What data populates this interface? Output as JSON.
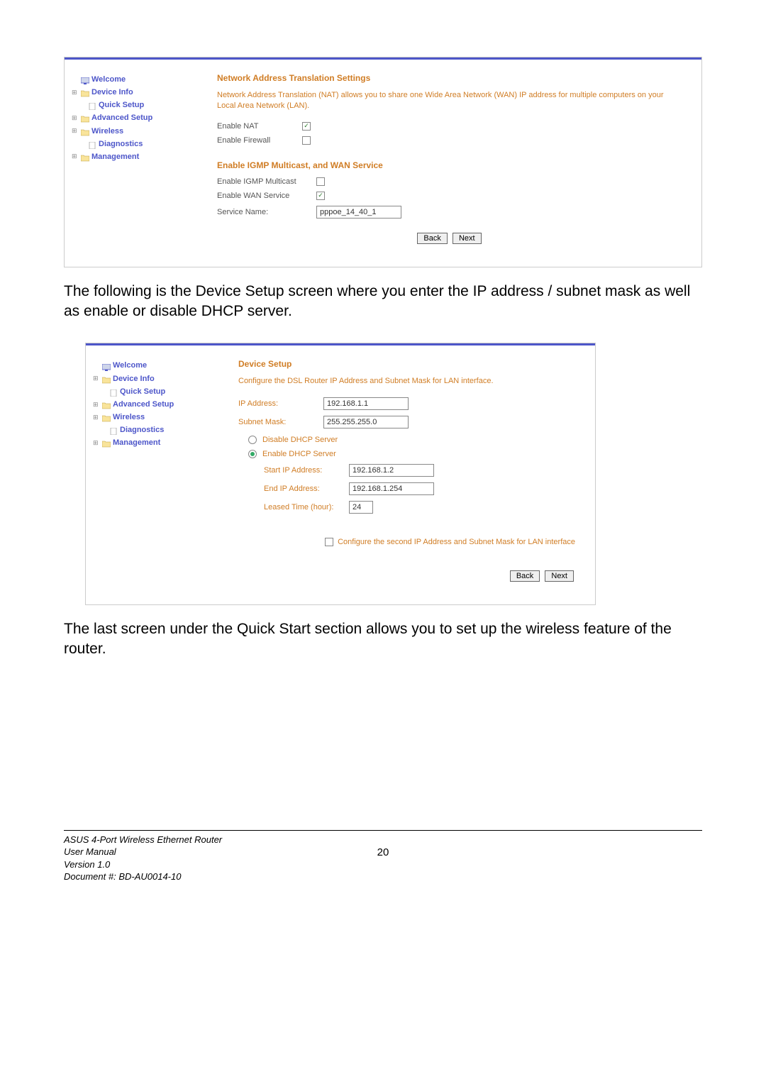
{
  "tree": {
    "welcome": "Welcome",
    "deviceInfo": "Device Info",
    "quickSetup": "Quick Setup",
    "advancedSetup": "Advanced Setup",
    "wireless": "Wireless",
    "diagnostics": "Diagnostics",
    "management": "Management"
  },
  "s1": {
    "title": "Network Address Translation Settings",
    "desc": "Network Address Translation (NAT) allows you to share one Wide Area Network (WAN) IP address for multiple computers on your Local Area Network (LAN).",
    "enableNat": "Enable NAT",
    "enableFirewall": "Enable Firewall",
    "title2": "Enable IGMP Multicast, and WAN Service",
    "enableIgmp": "Enable IGMP Multicast",
    "enableWan": "Enable WAN Service",
    "serviceName": "Service Name:",
    "serviceVal": "pppoe_14_40_1",
    "back": "Back",
    "next": "Next"
  },
  "p1": "The following is the Device Setup screen where you enter the IP address / subnet mask as well as enable or disable DHCP server.",
  "s2": {
    "title": "Device Setup",
    "desc": "Configure the DSL Router IP Address and Subnet Mask for LAN interface.",
    "ipAddr": "IP Address:",
    "ipVal": "192.168.1.1",
    "mask": "Subnet Mask:",
    "maskVal": "255.255.255.0",
    "disableDhcp": "Disable DHCP Server",
    "enableDhcp": "Enable DHCP Server",
    "startIp": "Start IP Address:",
    "startVal": "192.168.1.2",
    "endIp": "End IP Address:",
    "endVal": "192.168.1.254",
    "leased": "Leased Time (hour):",
    "leasedVal": "24",
    "cfg2nd": "Configure the second IP Address and Subnet Mask for LAN interface",
    "back": "Back",
    "next": "Next"
  },
  "p2": "The last screen under the Quick Start section allows you to set up the wireless feature of the router.",
  "footer": {
    "l1": "ASUS 4-Port Wireless Ethernet Router",
    "l2": "User Manual",
    "l3": "Version 1.0",
    "l4": "Document #:  BD-AU0014-10",
    "page": "20"
  }
}
